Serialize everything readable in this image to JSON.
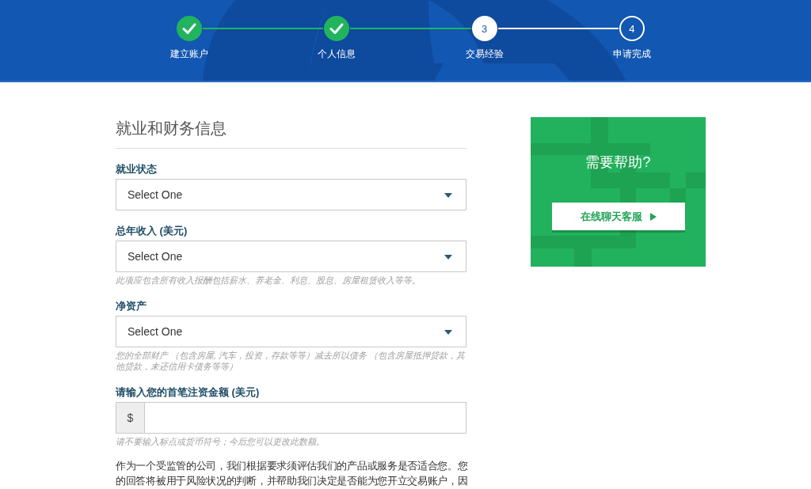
{
  "steps": [
    {
      "label": "建立账户",
      "completed": true,
      "selected": false
    },
    {
      "label": "个人信息",
      "completed": true,
      "selected": false
    },
    {
      "label": "交易经验",
      "completed": false,
      "selected": true,
      "number": "3"
    },
    {
      "label": "申请完成",
      "completed": false,
      "selected": false,
      "number": "4"
    }
  ],
  "section": {
    "title": "就业和财务信息"
  },
  "fields": [
    {
      "kind": "select",
      "label": "就业状态",
      "value": "Select One"
    },
    {
      "kind": "select",
      "label": "总年收入 (美元)",
      "value": "Select One",
      "hint": "此项应包含所有收入报酬包括薪水、养老金、利息、股息、房屋租赁收入等等。"
    },
    {
      "kind": "select",
      "label": "净资产",
      "value": "Select One",
      "hint": "您的全部财产 （包含房屋, 汽车，投资，存款等等）减去所以债务 （包含房屋抵押贷款，其他贷款，未还信用卡债务等等）"
    },
    {
      "kind": "currency",
      "label": "请输入您的首笔注资金额 (美元)",
      "prefix": "$",
      "hint": "请不要输入标点或货币符号；今后您可以更改此数额。"
    }
  ],
  "paragraph": "作为一个受监管的公司，我们根据要求须评估我们的产品或服务是否适合您。您的回答将被用于风险状况的判断，并帮助我们决定是否能为您开立交易账户，因",
  "help_card": {
    "title": "需要帮助?",
    "button": "在线聊天客服"
  }
}
